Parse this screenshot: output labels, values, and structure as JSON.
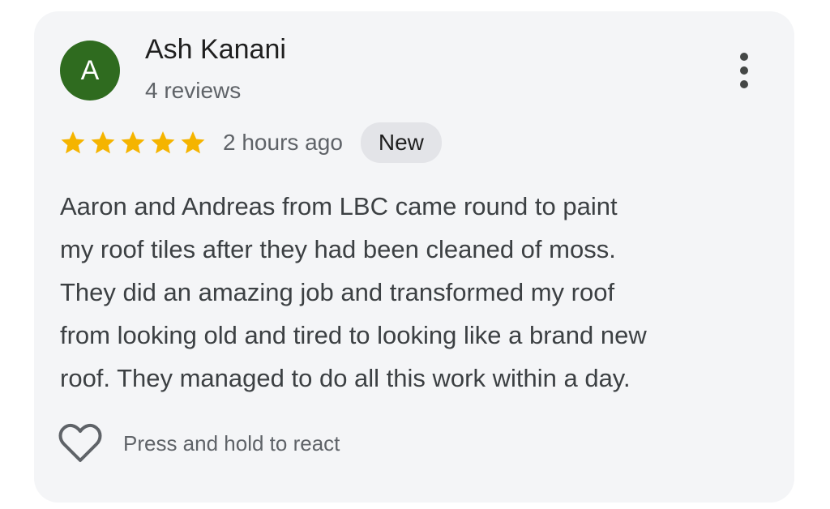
{
  "reviewer": {
    "avatar_letter": "A",
    "name": "Ash Kanani",
    "review_count": "4 reviews"
  },
  "rating": {
    "stars": 5,
    "max_stars": 5,
    "time": "2 hours ago",
    "badge": "New"
  },
  "review": {
    "lines": [
      "Aaron and Andreas from LBC came round to paint",
      "my roof tiles after they had been cleaned of moss.",
      "They did an amazing job and transformed my roof",
      "from looking old and tired to looking like a brand new",
      "roof. They managed to do all this work within a day."
    ]
  },
  "reactions": {
    "label": "Press and hold to react",
    "icon": "heart-icon"
  },
  "colors": {
    "avatar_bg": "#2f6b1f",
    "star": "#f5b400",
    "card_bg": "#f4f5f7",
    "badge_bg": "#e3e4e8"
  },
  "icons": {
    "more": "more-vert-icon",
    "star": "star-icon"
  }
}
